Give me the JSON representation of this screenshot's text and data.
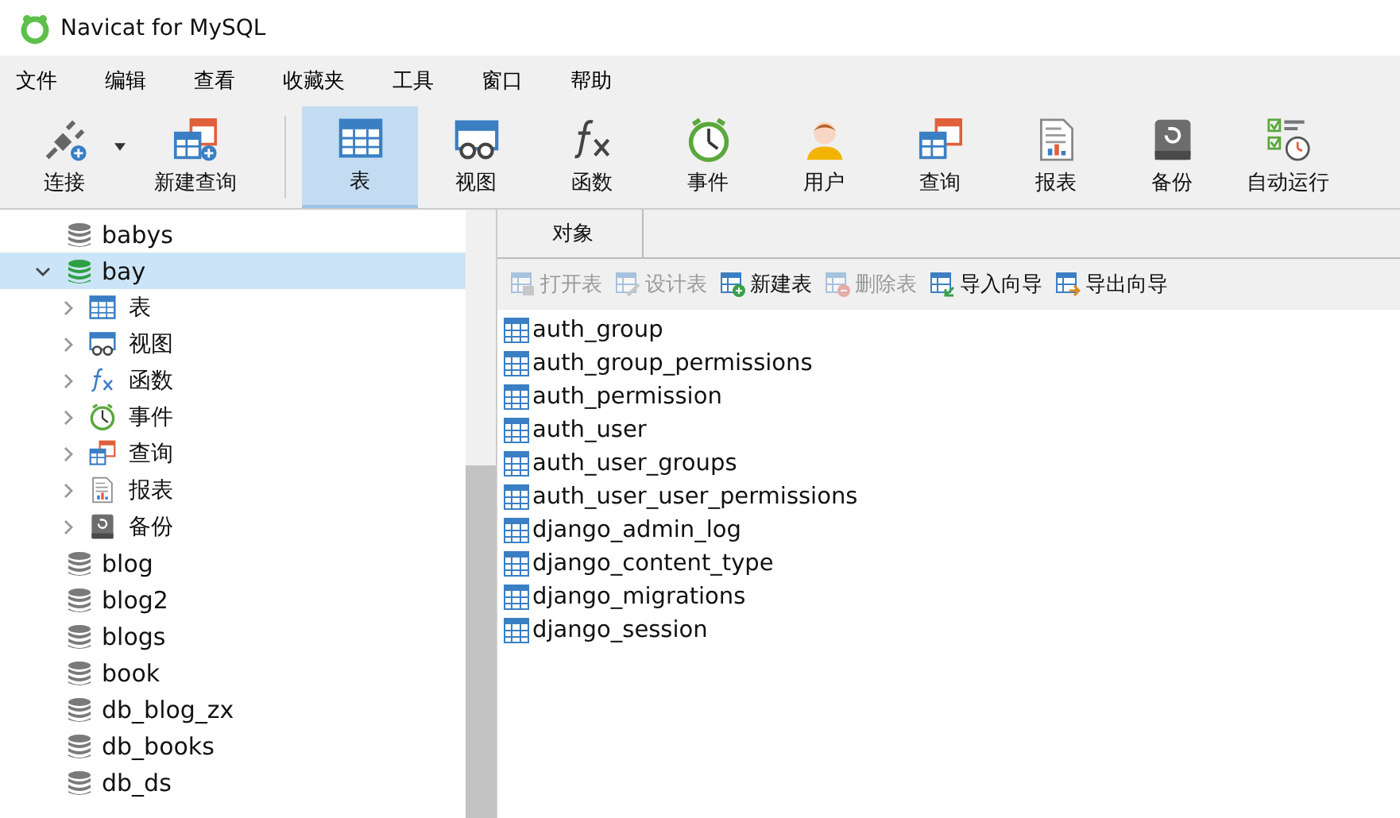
{
  "window": {
    "title": "Navicat for MySQL"
  },
  "menu": [
    "文件",
    "编辑",
    "查看",
    "收藏夹",
    "工具",
    "窗口",
    "帮助"
  ],
  "toolbar": [
    {
      "label": "连接",
      "kind": "connect",
      "selected": false,
      "dropdown": true
    },
    {
      "label": "新建查询",
      "kind": "newquery",
      "selected": false
    },
    {
      "label": "表",
      "kind": "table",
      "selected": true
    },
    {
      "label": "视图",
      "kind": "view",
      "selected": false
    },
    {
      "label": "函数",
      "kind": "function",
      "selected": false
    },
    {
      "label": "事件",
      "kind": "event",
      "selected": false
    },
    {
      "label": "用户",
      "kind": "user",
      "selected": false
    },
    {
      "label": "查询",
      "kind": "query",
      "selected": false
    },
    {
      "label": "报表",
      "kind": "report",
      "selected": false
    },
    {
      "label": "备份",
      "kind": "backup",
      "selected": false
    },
    {
      "label": "自动运行",
      "kind": "automation",
      "selected": false
    }
  ],
  "tree": [
    {
      "label": "babys",
      "open": false,
      "selected": false
    },
    {
      "label": "bay",
      "open": true,
      "selected": true,
      "expanded": true,
      "children": [
        {
          "label": "表",
          "kind": "table"
        },
        {
          "label": "视图",
          "kind": "view"
        },
        {
          "label": "函数",
          "kind": "function"
        },
        {
          "label": "事件",
          "kind": "event"
        },
        {
          "label": "查询",
          "kind": "query"
        },
        {
          "label": "报表",
          "kind": "report"
        },
        {
          "label": "备份",
          "kind": "backup"
        }
      ]
    },
    {
      "label": "blog",
      "open": false,
      "selected": false
    },
    {
      "label": "blog2",
      "open": false,
      "selected": false
    },
    {
      "label": "blogs",
      "open": false,
      "selected": false
    },
    {
      "label": "book",
      "open": false,
      "selected": false
    },
    {
      "label": "db_blog_zx",
      "open": false,
      "selected": false
    },
    {
      "label": "db_books",
      "open": false,
      "selected": false
    },
    {
      "label": "db_ds",
      "open": false,
      "selected": false
    }
  ],
  "tabs": [
    {
      "label": "对象",
      "selected": true
    }
  ],
  "object_actions": [
    {
      "label": "打开表",
      "kind": "open",
      "disabled": true
    },
    {
      "label": "设计表",
      "kind": "design",
      "disabled": true
    },
    {
      "label": "新建表",
      "kind": "new",
      "disabled": false
    },
    {
      "label": "删除表",
      "kind": "delete",
      "disabled": true
    },
    {
      "label": "导入向导",
      "kind": "import",
      "disabled": false
    },
    {
      "label": "导出向导",
      "kind": "export",
      "disabled": false
    }
  ],
  "objects": [
    "auth_group",
    "auth_group_permissions",
    "auth_permission",
    "auth_user",
    "auth_user_groups",
    "auth_user_user_permissions",
    "django_admin_log",
    "django_content_type",
    "django_migrations",
    "django_session"
  ]
}
